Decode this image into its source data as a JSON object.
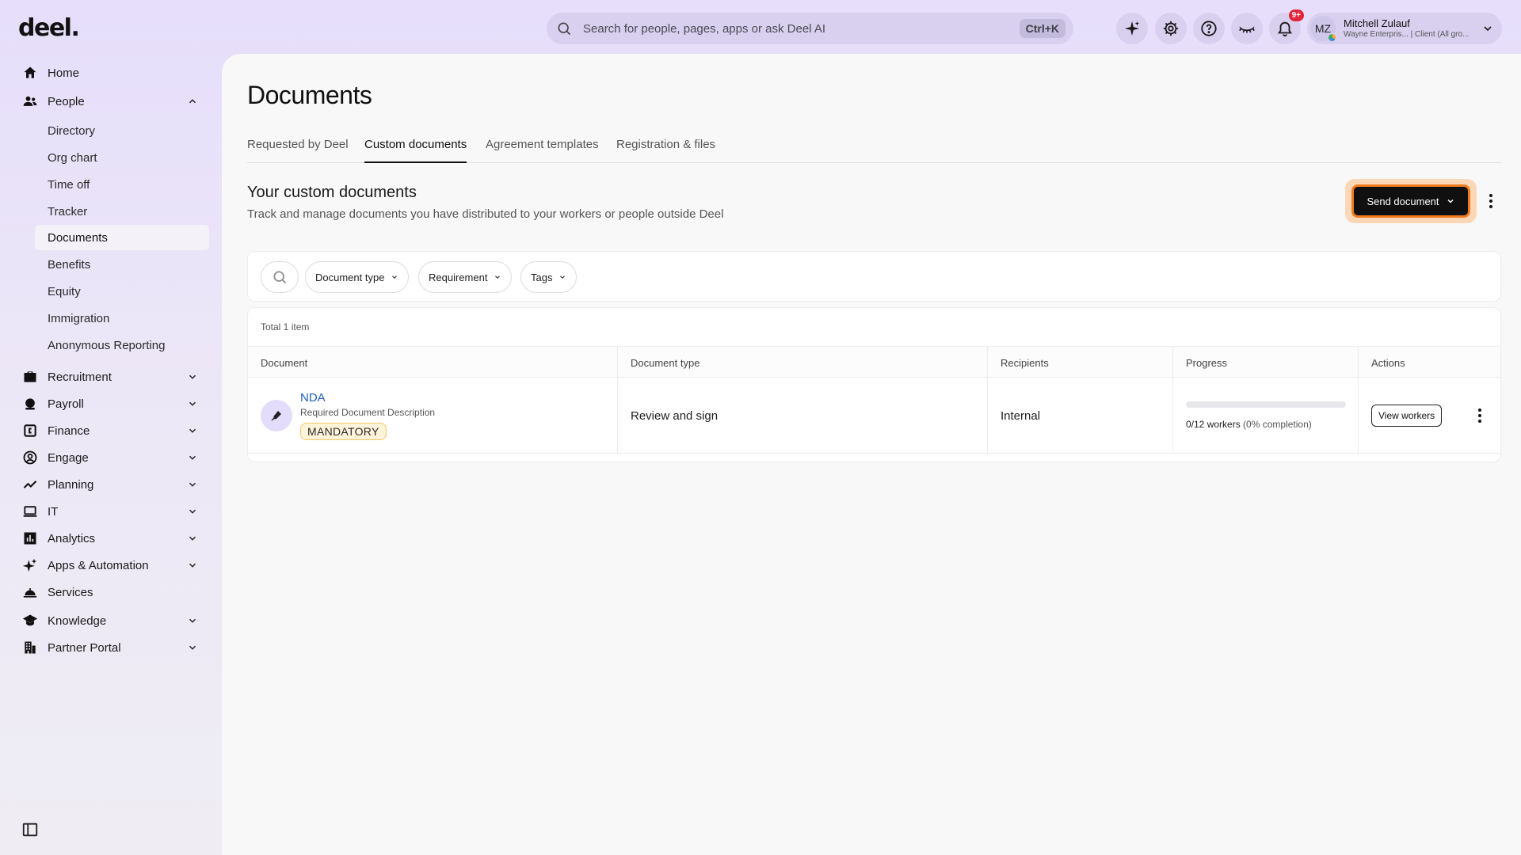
{
  "app": {
    "logo": "deel."
  },
  "search": {
    "placeholder": "Search for people, pages, apps or ask Deel AI",
    "shortcut": "Ctrl+K"
  },
  "topbar": {
    "icons": [
      "sparkle-ai-icon",
      "gear-icon",
      "help-icon",
      "eye-closed-icon",
      "bell-icon"
    ],
    "notification_count": "9+"
  },
  "user": {
    "initials": "MZ",
    "name": "Mitchell Zulauf",
    "subtitle": "Wayne Enterpris... | Client (All gro..."
  },
  "sidebar": {
    "items": [
      {
        "label": "Home",
        "icon": "home-icon"
      },
      {
        "label": "People",
        "icon": "people-icon",
        "expanded": true,
        "children": [
          "Directory",
          "Org chart",
          "Time off",
          "Tracker",
          "Documents",
          "Benefits",
          "Equity",
          "Immigration",
          "Anonymous Reporting"
        ],
        "active_child": "Documents"
      },
      {
        "label": "Recruitment",
        "icon": "briefcase-icon"
      },
      {
        "label": "Payroll",
        "icon": "payroll-icon"
      },
      {
        "label": "Finance",
        "icon": "finance-icon"
      },
      {
        "label": "Engage",
        "icon": "engage-icon"
      },
      {
        "label": "Planning",
        "icon": "trend-icon"
      },
      {
        "label": "IT",
        "icon": "laptop-icon"
      },
      {
        "label": "Analytics",
        "icon": "analytics-icon"
      },
      {
        "label": "Apps & Automation",
        "icon": "sparkle-icon"
      },
      {
        "label": "Services",
        "icon": "service-bell-icon"
      },
      {
        "label": "Knowledge",
        "icon": "graduation-cap-icon"
      },
      {
        "label": "Partner Portal",
        "icon": "building-icon"
      }
    ]
  },
  "page": {
    "title": "Documents",
    "tabs": [
      "Requested by Deel",
      "Custom documents",
      "Agreement templates",
      "Registration & files"
    ],
    "active_tab": "Custom documents",
    "section_title": "Your custom documents",
    "section_subtitle": "Track and manage documents you have distributed to your workers or people outside Deel",
    "send_button": "Send document"
  },
  "filters": [
    "Document type",
    "Requirement",
    "Tags"
  ],
  "table": {
    "total": "Total 1 item",
    "columns": [
      "Document",
      "Document type",
      "Recipients",
      "Progress",
      "Actions"
    ],
    "rows": [
      {
        "name": "NDA",
        "description": "Required Document Description",
        "badge": "MANDATORY",
        "type": "Review and sign",
        "recipients": "Internal",
        "progress_text": "0/12 workers",
        "progress_pct_text": "(0% completion)",
        "progress_fraction": 0,
        "action": "View workers"
      }
    ]
  },
  "colors": {
    "accent": "#6d4cdb",
    "focus_ring": "#f07a1c",
    "link": "#1f5fb8",
    "badge_bg": "#fff4d9"
  }
}
